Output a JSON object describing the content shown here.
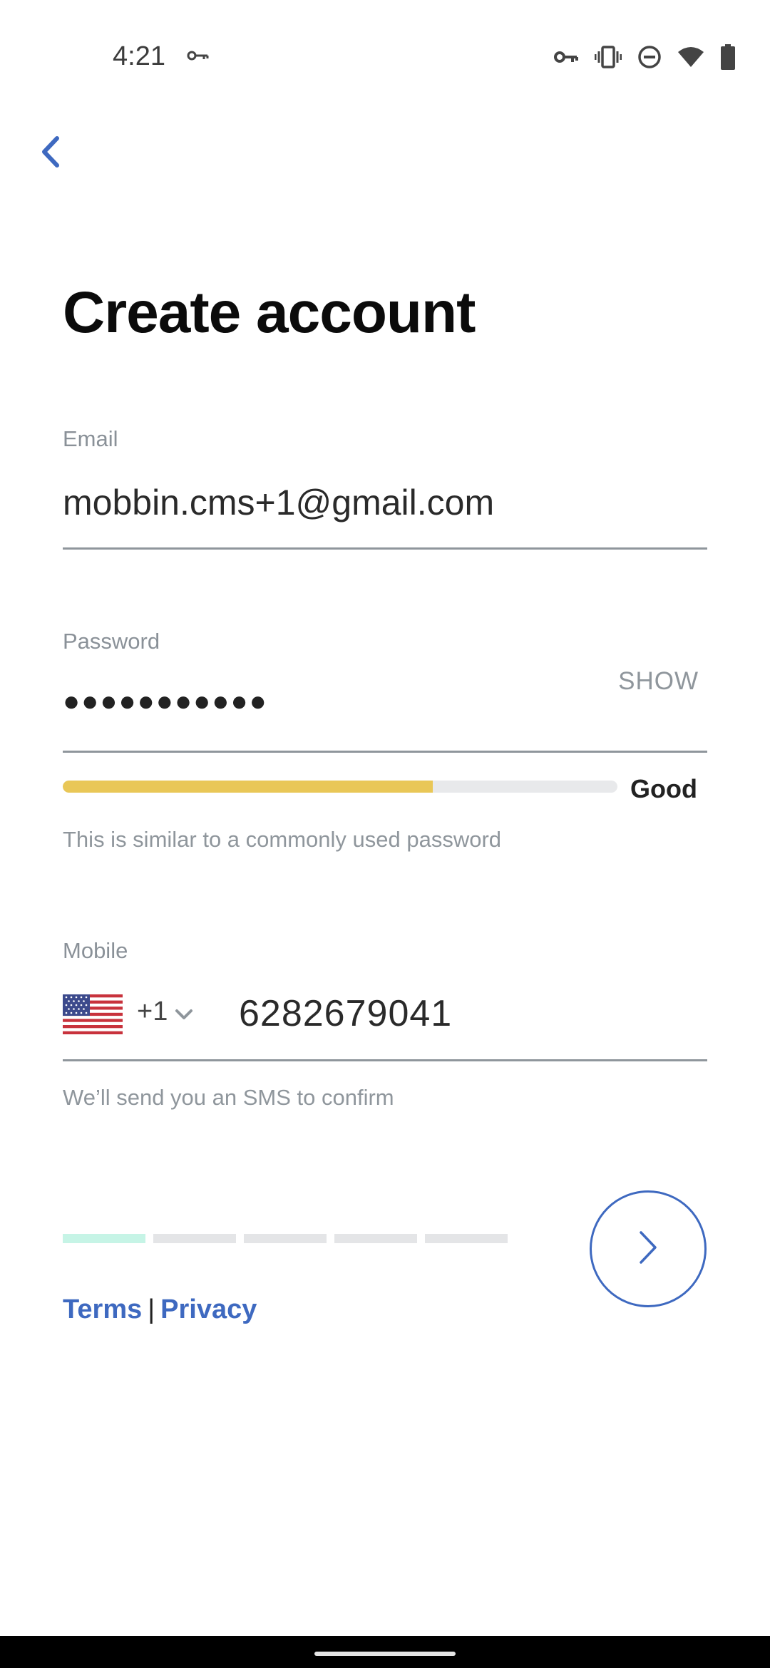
{
  "status_bar": {
    "time": "4:21",
    "icons": [
      "key-icon",
      "vpn-key-icon",
      "vibrate-icon",
      "do-not-disturb-icon",
      "wifi-icon",
      "battery-icon"
    ]
  },
  "header": {
    "back_icon": "chevron-left-icon",
    "title": "Create account"
  },
  "form": {
    "email": {
      "label": "Email",
      "value": "mobbin.cms+1@gmail.com"
    },
    "password": {
      "label": "Password",
      "masked_value": "●●●●●●●●●●●",
      "show_label": "SHOW",
      "strength_fraction": 0.667,
      "strength_label": "Good",
      "hint": "This is similar to a commonly used password"
    },
    "mobile": {
      "label": "Mobile",
      "country_flag": "us-flag-icon",
      "country_code": "+1",
      "value": "6282679041",
      "hint": "We’ll send you an SMS to confirm"
    }
  },
  "progress": {
    "steps_total": 5,
    "active_step": 1
  },
  "legal": {
    "terms": "Terms",
    "separator": "|",
    "privacy": "Privacy"
  },
  "colors": {
    "accent": "#3e69c0",
    "strength_fill": "#e9c757",
    "progress_active": "#c6f4e6",
    "muted_text": "#8f969c"
  }
}
